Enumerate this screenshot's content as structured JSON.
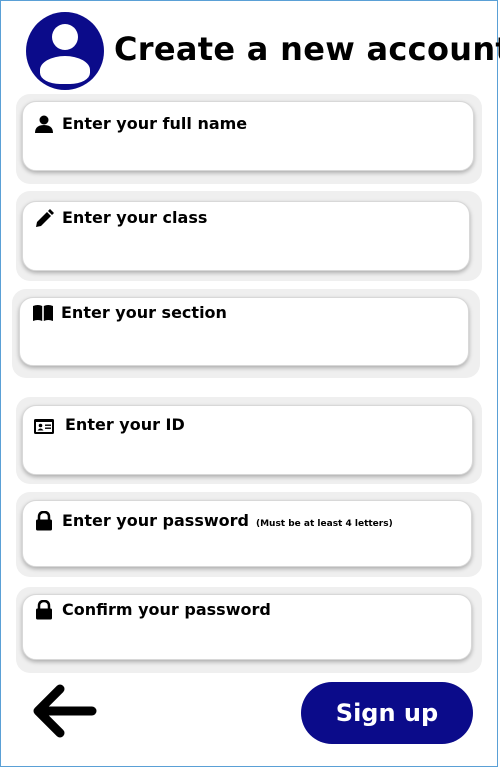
{
  "header": {
    "title": "Create a new account",
    "avatar_icon": "user-avatar-icon"
  },
  "fields": [
    {
      "label": "Enter your full name",
      "icon": "user-icon"
    },
    {
      "label": "Enter your class",
      "icon": "pencil-icon"
    },
    {
      "label": "Enter your section",
      "icon": "book-icon"
    },
    {
      "label": "Enter your ID",
      "icon": "id-card-icon"
    },
    {
      "label": "Enter your password",
      "note": "(Must be at least 4 letters)",
      "icon": "lock-icon"
    },
    {
      "label": "Confirm your password",
      "icon": "lock-icon"
    }
  ],
  "actions": {
    "back_icon": "back-arrow-icon",
    "signup_label": "Sign up"
  },
  "colors": {
    "accent": "#0b0b8a",
    "panel": "#efefef",
    "border": "#5aa0d6"
  }
}
